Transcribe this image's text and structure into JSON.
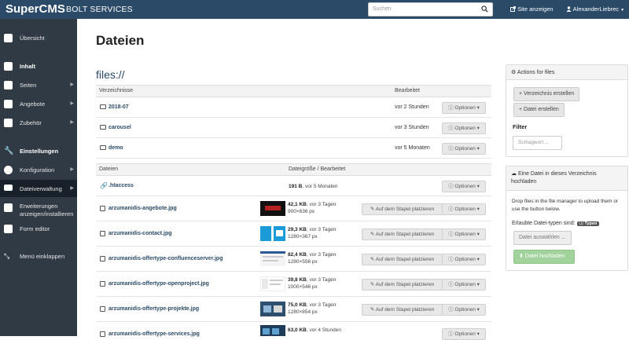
{
  "header": {
    "brand": "SuperCMS",
    "site_name": "BOLT SERVICES",
    "search_placeholder": "Suchen",
    "view_site": "Site anzeigen",
    "user": "AlexanderLiebrec"
  },
  "sidebar": {
    "items": [
      {
        "label": "Übersicht",
        "icon": "dashboard-icon"
      },
      {
        "label": "Inhalt",
        "icon": "content-icon"
      },
      {
        "label": "Seiten",
        "icon": "pages-icon"
      },
      {
        "label": "Angebote",
        "icon": "offers-icon"
      },
      {
        "label": "Zubehör",
        "icon": "accessories-icon"
      },
      {
        "label": "Einstellungen",
        "icon": "wrench-icon"
      },
      {
        "label": "Konfiguration",
        "icon": "gear-icon"
      },
      {
        "label": "Dateiverwaltung",
        "icon": "folder-icon"
      },
      {
        "label_line1": "Erweiterungen",
        "label_line2": "anzeigen/installieren",
        "icon": "extensions-icon"
      },
      {
        "label": "Form editor",
        "icon": "form-icon"
      },
      {
        "label": "Menü einklappen",
        "icon": "collapse-icon"
      }
    ]
  },
  "main": {
    "title": "Dateien",
    "breadcrumb": "files://",
    "directories_header": "Verzeichnisse",
    "edited_header": "Bearbeitet",
    "options_label": "Optionen",
    "directories": [
      {
        "name": "2018-07",
        "edited": "vor 2 Stunden"
      },
      {
        "name": "carousel",
        "edited": "vor 3 Stunden"
      },
      {
        "name": "demo",
        "edited": "vor 5 Monaten"
      }
    ],
    "files_header": "Dateien",
    "size_header": "Dateigröße / Bearbeitet",
    "stack_label": "Auf dem Stapel platzieren",
    "files": [
      {
        "name": ".htaccess",
        "size": "191 B",
        "edited": "vor 5 Monaten",
        "dims": ""
      },
      {
        "name": "arzumanidis-angebote.jpg",
        "size": "42,1 KB",
        "edited": "vor 3 Tagen",
        "dims": "900×636 px"
      },
      {
        "name": "arzumanidis-contact.jpg",
        "size": "29,3 KB",
        "edited": "vor 3 Tagen",
        "dims": "1280×367 px"
      },
      {
        "name": "arzumanidis-offertype-confluenceserver.jpg",
        "size": "82,4 KB",
        "edited": "vor 3 Tagen",
        "dims": "1280×556 px"
      },
      {
        "name": "arzumanidis-offertype-openproject.jpg",
        "size": "39,8 KB",
        "edited": "vor 3 Tagen",
        "dims": "1000×546 px"
      },
      {
        "name": "arzumanidis-offertype-projekte.jpg",
        "size": "75,0 KB",
        "edited": "vor 3 Tagen",
        "dims": "1280×854 px"
      },
      {
        "name": "arzumanidis-offertype-services.jpg",
        "size": "63,0 KB",
        "edited": "vor 4 Stunden",
        "dims": ""
      }
    ]
  },
  "actions": {
    "title": "Actions for files",
    "create_dir": "+ Verzeichnis erstellen",
    "create_file": "+ Datei erstellen",
    "filter_label": "Filter",
    "filter_placeholder": "Schlagwort ..."
  },
  "upload": {
    "title": "Eine Datei in dieses Verzeichnis hochladen",
    "hint": "Drop files in the file manager to upload them or use the button below.",
    "allowed_label": "Erlaubte Datei-typen sind:",
    "types_badge": "Typen",
    "choose_button": "Datei auswählen ...",
    "upload_button": "Datei hochladen"
  },
  "colors": {
    "topbar": "#2a4a68",
    "sidebar": "#2f3a45",
    "upload_button": "#a3d39c"
  }
}
